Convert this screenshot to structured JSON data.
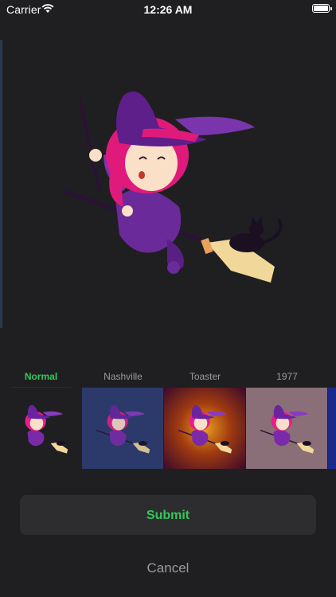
{
  "status_bar": {
    "carrier": "Carrier",
    "time": "12:26 AM"
  },
  "filters": [
    {
      "label": "Normal",
      "active": true,
      "bg": "#1f1f21"
    },
    {
      "label": "Nashville",
      "active": false,
      "bg": "#2b3a6a"
    },
    {
      "label": "Toaster",
      "active": false,
      "bg": "#7a2a10"
    },
    {
      "label": "1977",
      "active": false,
      "bg": "#8a6f78"
    }
  ],
  "actions": {
    "submit_label": "Submit",
    "cancel_label": "Cancel"
  },
  "colors": {
    "accent": "#34c759",
    "background": "#1f1f21",
    "button_bg": "#2d2d2f"
  }
}
